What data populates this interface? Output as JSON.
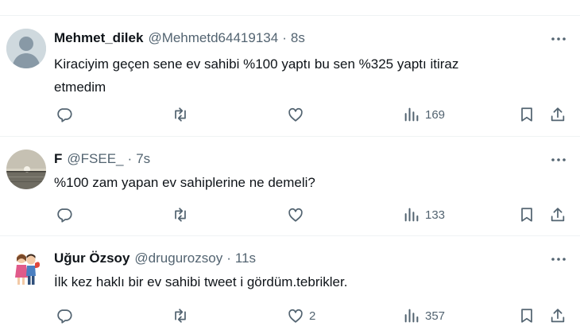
{
  "tweets": [
    {
      "name": "Mehmet_dilek",
      "handle": "@Mehmetd64419134",
      "separator": "·",
      "time": "8s",
      "text": "Kiraciyim geçen sene ev sahibi %100 yaptı bu sen %325 yaptı itiraz etmedim",
      "views": "169",
      "likes": ""
    },
    {
      "name": "F",
      "handle": "@FSEE_",
      "separator": "·",
      "time": "7s",
      "text": "%100 zam yapan ev sahiplerine ne demeli?",
      "views": "133",
      "likes": ""
    },
    {
      "name": "Uğur Özsoy",
      "handle": "@drugurozsoy",
      "separator": "·",
      "time": "11s",
      "text": "İlk kez haklı bir ev sahibi tweet i gördüm.tebrikler.",
      "views": "357",
      "likes": "2"
    }
  ],
  "icons": {
    "reply": "reply-icon",
    "retweet": "retweet-icon",
    "like": "like-icon",
    "views": "views-icon",
    "bookmark": "bookmark-icon",
    "share": "share-icon",
    "more": "more-icon"
  },
  "colors": {
    "text_primary": "#0f1419",
    "text_secondary": "#536471",
    "divider": "#eff3f4"
  }
}
